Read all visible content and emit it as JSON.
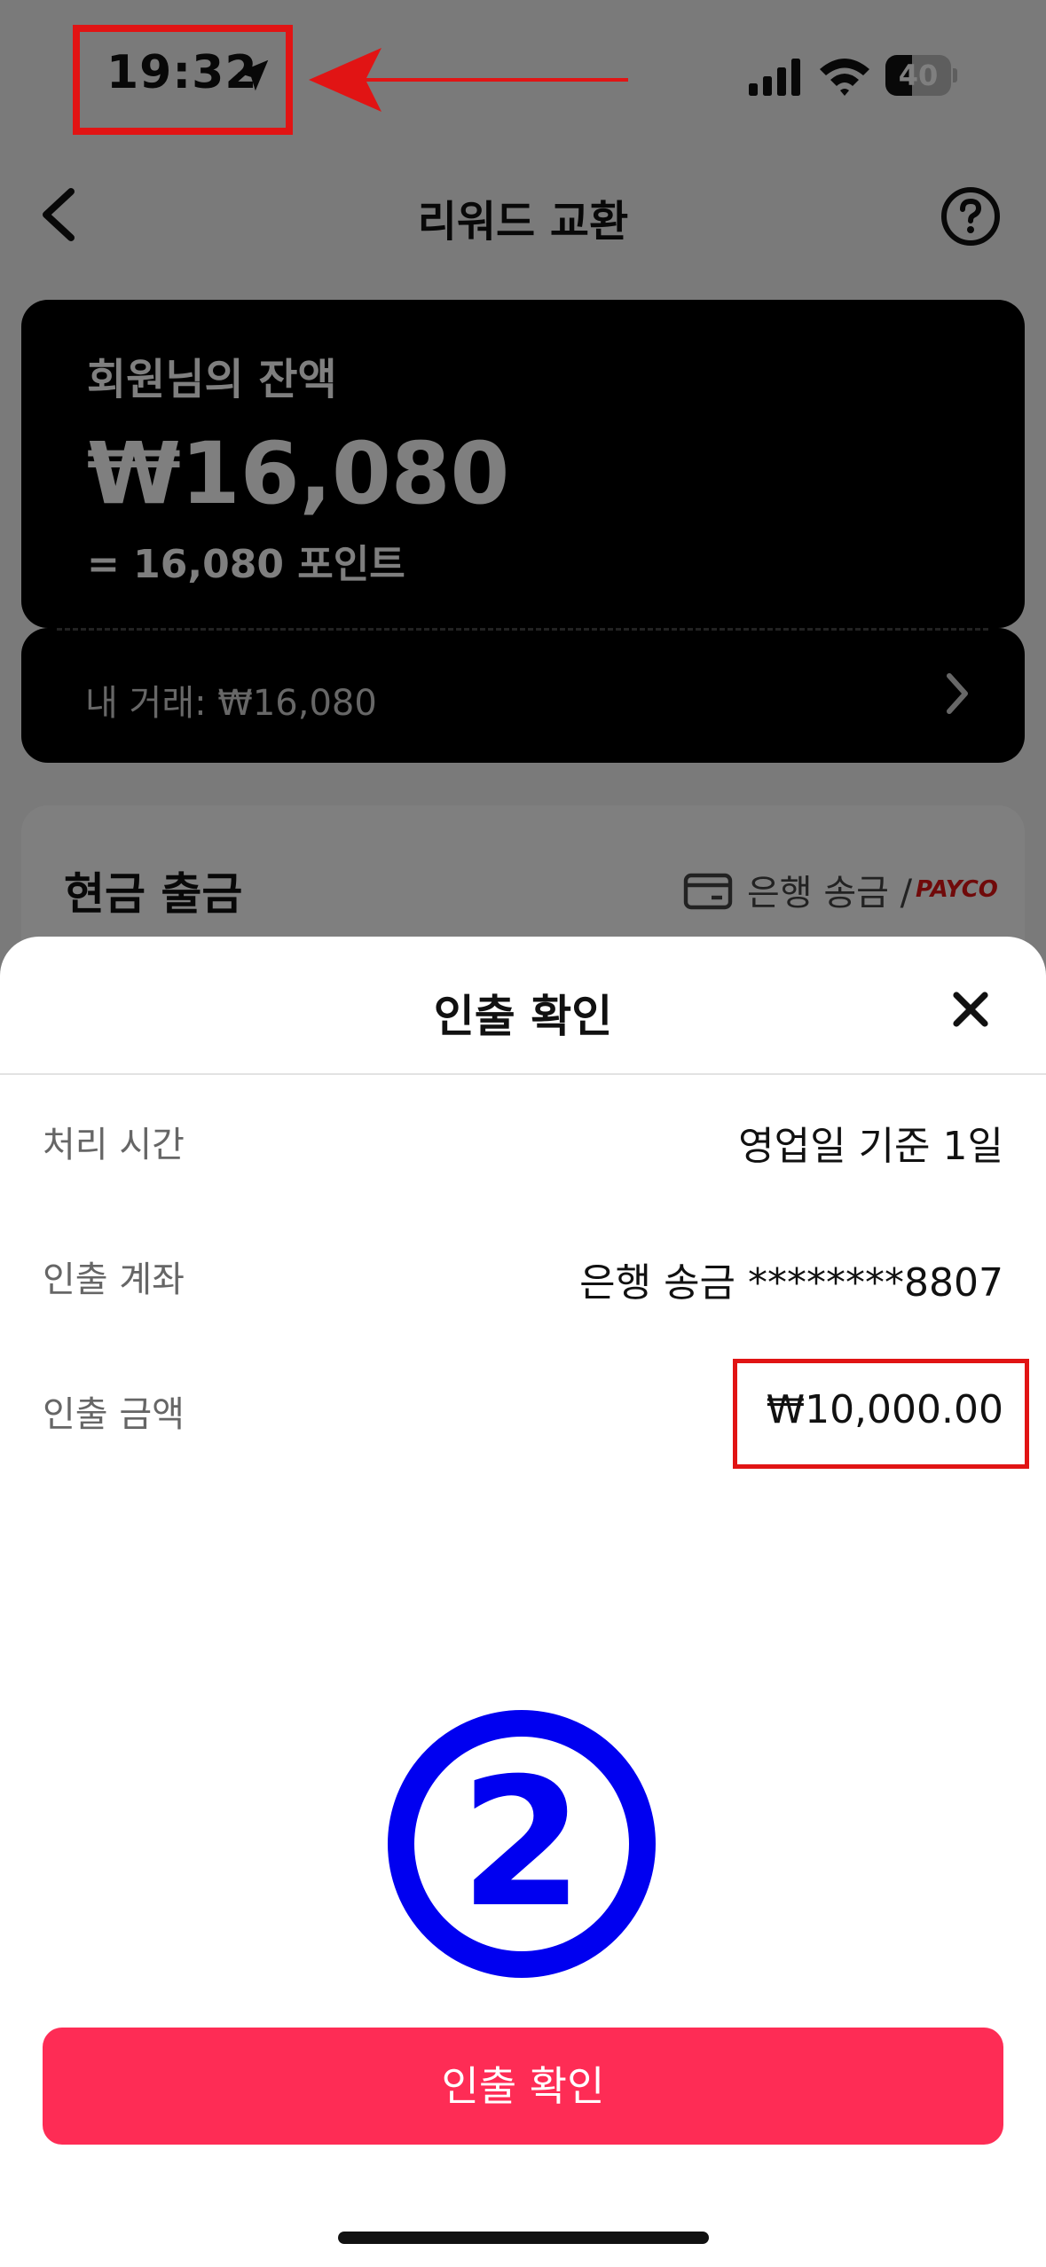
{
  "status_bar": {
    "time": "19:32",
    "battery_level": 40,
    "battery_text": "40"
  },
  "nav": {
    "title": "리워드 교환"
  },
  "balance_card": {
    "label": "회원님의 잔액",
    "amount": "₩16,080",
    "points": "= 16,080 포인트",
    "transactions_label": "내 거래: ₩16,080"
  },
  "cash_withdrawal": {
    "title": "현금 출금",
    "methods": "은행 송금 /",
    "payco": "PAYCO"
  },
  "sheet": {
    "title": "인출 확인",
    "rows": [
      {
        "label": "처리 시간",
        "value": "영업일 기준 1일"
      },
      {
        "label": "인출 계좌",
        "value": "은행 송금 ********8807"
      },
      {
        "label": "인출 금액",
        "value": "₩10,000.00"
      }
    ],
    "step_marker": "2",
    "confirm_label": "인출 확인"
  },
  "colors": {
    "accent": "#fe2c55",
    "annotation_red": "#e11414",
    "annotation_blue": "#0000f0"
  }
}
